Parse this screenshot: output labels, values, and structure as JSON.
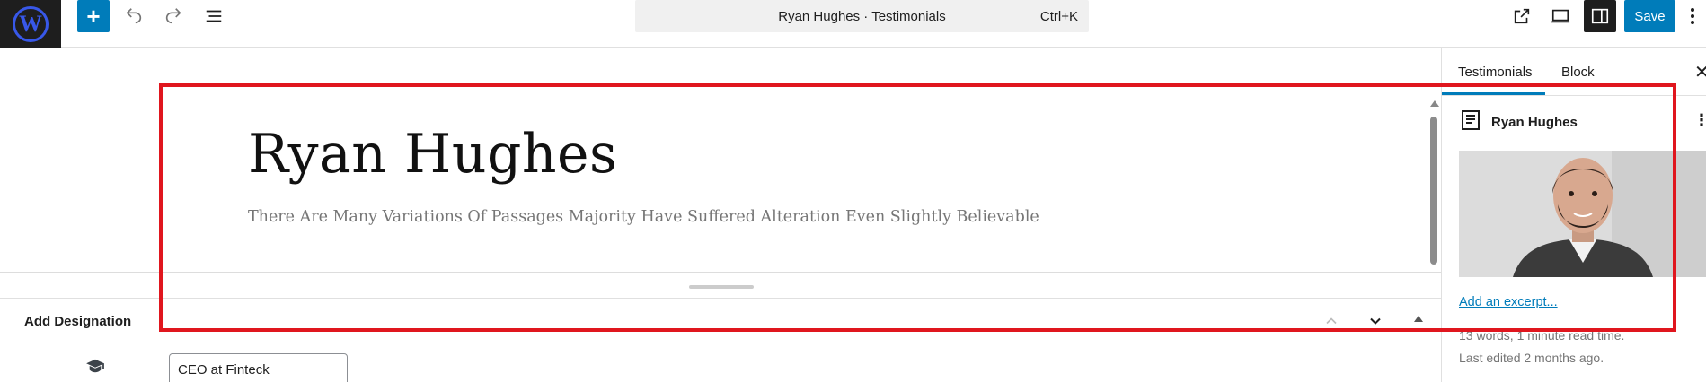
{
  "topbar": {
    "logo_icon": "wordpress-logo-icon",
    "add_icon": "plus-icon",
    "undo_icon": "undo-icon",
    "redo_icon": "redo-icon",
    "list_view_icon": "list-view-icon",
    "command_title": "Ryan Hughes · Testimonials",
    "command_shortcut": "Ctrl+K",
    "view_icon": "external-link-icon",
    "preview_icon": "desktop-preview-icon",
    "settings_icon": "settings-sidebar-icon",
    "save_label": "Save",
    "options_icon": "vertical-ellipsis-icon"
  },
  "editor": {
    "title": "Ryan Hughes",
    "subtitle": "There Are Many Variations Of Passages Majority Have Suffered Alteration Even Slightly Believable"
  },
  "meta_box": {
    "title": "Add Designation",
    "icon": "graduation-cap-icon",
    "designation_value": "CEO at Finteck"
  },
  "sidebar": {
    "tabs": [
      "Testimonials",
      "Block"
    ],
    "active_tab": "Testimonials",
    "doc_icon": "post-document-icon",
    "doc_title": "Ryan Hughes",
    "featured_image_icon": "featured-image-portrait",
    "excerpt_link": "Add an excerpt...",
    "word_count": "13 words, 1 minute read time.",
    "last_edited": "Last edited 2 months ago."
  },
  "colors": {
    "accent": "#007cba",
    "highlight": "#e0161e",
    "dark": "#1e1e1e"
  }
}
